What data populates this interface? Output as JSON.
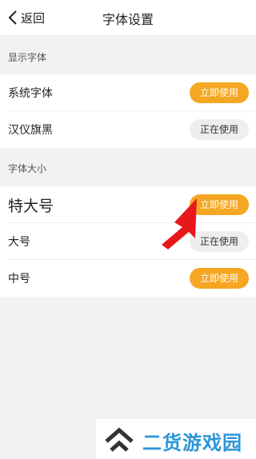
{
  "header": {
    "back_label": "返回",
    "title": "字体设置"
  },
  "sections": {
    "display_font": {
      "title": "显示字体",
      "rows": [
        {
          "label": "系统字体",
          "button": "立即使用"
        },
        {
          "label": "汉仪旗黑",
          "button": "正在使用"
        }
      ]
    },
    "font_size": {
      "title": "字体大小",
      "rows": [
        {
          "label": "特大号",
          "button": "立即使用"
        },
        {
          "label": "大号",
          "button": "正在使用"
        },
        {
          "label": "中号",
          "button": "立即使用"
        }
      ]
    }
  },
  "colors": {
    "accent": "#f5a623",
    "in_use_bg": "#eeeeee",
    "annotation": "#e8181a",
    "watermark": "#2a97d8"
  },
  "watermark": {
    "text": "二货游戏园"
  }
}
